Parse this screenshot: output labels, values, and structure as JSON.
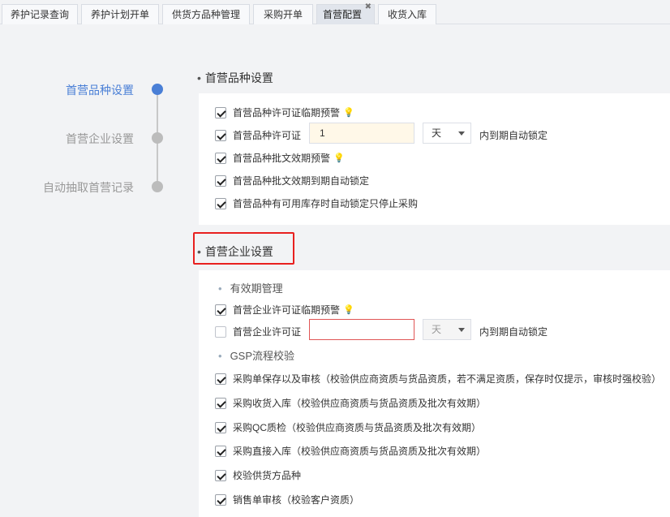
{
  "tabs": [
    {
      "label": "养护记录查询",
      "active": false
    },
    {
      "label": "养护计划开单",
      "active": false
    },
    {
      "label": "供货方品种管理",
      "active": false
    },
    {
      "label": "采购开单",
      "active": false
    },
    {
      "label": "首营配置",
      "active": true,
      "close": "✖"
    },
    {
      "label": "收货入库",
      "active": false
    }
  ],
  "steps": [
    {
      "label": "首营品种设置",
      "active": true
    },
    {
      "label": "首营企业设置",
      "active": false
    },
    {
      "label": "自动抽取首营记录",
      "active": false
    }
  ],
  "product_section": {
    "title": "首营品种设置",
    "rows": [
      {
        "label": "首营品种许可证临期预警",
        "checked": true,
        "bulb": true
      },
      {
        "label": "首营品种许可证",
        "checked": true,
        "input_value": "1",
        "unit": "天",
        "suffix": "内到期自动锁定"
      },
      {
        "label": "首营品种批文效期预警",
        "checked": true,
        "bulb": true
      },
      {
        "label": "首营品种批文效期到期自动锁定",
        "checked": true
      },
      {
        "label": "首营品种有可用库存时自动锁定只停止采购",
        "checked": true
      }
    ]
  },
  "enterprise_section": {
    "title": "首营企业设置",
    "validity_head": "有效期管理",
    "validity_rows": [
      {
        "label": "首营企业许可证临期预警",
        "checked": true,
        "bulb": true
      },
      {
        "label": "首营企业许可证",
        "checked": false,
        "input_value": "",
        "unit": "天",
        "suffix": "内到期自动锁定"
      }
    ],
    "gsp_head": "GSP流程校验",
    "gsp_rows": [
      {
        "label": "采购单保存以及审核（校验供应商资质与货品资质，若不满足资质，保存时仅提示，审核时强校验）",
        "checked": true
      },
      {
        "label": "采购收货入库（校验供应商资质与货品资质及批次有效期）",
        "checked": true
      },
      {
        "label": "采购QC质检（校验供应商资质与货品资质及批次有效期）",
        "checked": true
      },
      {
        "label": "采购直接入库（校验供应商资质与货品资质及批次有效期）",
        "checked": true
      },
      {
        "label": "校验供货方品种",
        "checked": true
      },
      {
        "label": "销售单审核（校验客户资质）",
        "checked": true
      }
    ]
  },
  "colors": {
    "accent": "#4a7fd6",
    "highlight": "#e8201f",
    "bulb": "#f0a868"
  },
  "icons": {
    "bulb": "bulb-icon",
    "caret": "chevron-down-icon",
    "close": "close-icon",
    "check": "check-icon"
  }
}
